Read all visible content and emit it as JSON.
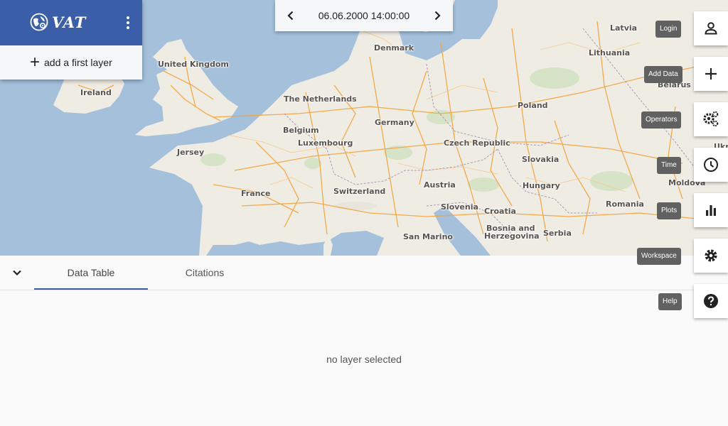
{
  "app": {
    "logo_text": "VAT"
  },
  "layer_panel": {
    "add_label": "add a first layer"
  },
  "time": {
    "value": "06.06.2000 14:00:00"
  },
  "map": {
    "labels": [
      "United Kingdom",
      "Ireland",
      "Denmark",
      "Latvia",
      "Lithuania",
      "Belarus",
      "The Netherlands",
      "Belgium",
      "Luxembourg",
      "Germany",
      "Poland",
      "Czech Republic",
      "Jersey",
      "Slovakia",
      "France",
      "Austria",
      "Hungary",
      "Switzerland",
      "Moldova",
      "Slovenia",
      "Croatia",
      "Romania",
      "Bosnia and",
      "Herzegovina",
      "Serbia",
      "San Marino",
      "Ukr"
    ]
  },
  "toolbar": {
    "login": "Login",
    "add_data": "Add Data",
    "operators": "Operators",
    "time": "Time",
    "plots": "Plots",
    "workspace": "Workspace",
    "help": "Help"
  },
  "bottom": {
    "tabs": [
      "Data Table",
      "Citations"
    ],
    "empty_message": "no layer selected"
  },
  "colors": {
    "header": "#3a5ea8",
    "water": "#a4c0db",
    "land": "#efece4",
    "road": "#f3a23c"
  }
}
